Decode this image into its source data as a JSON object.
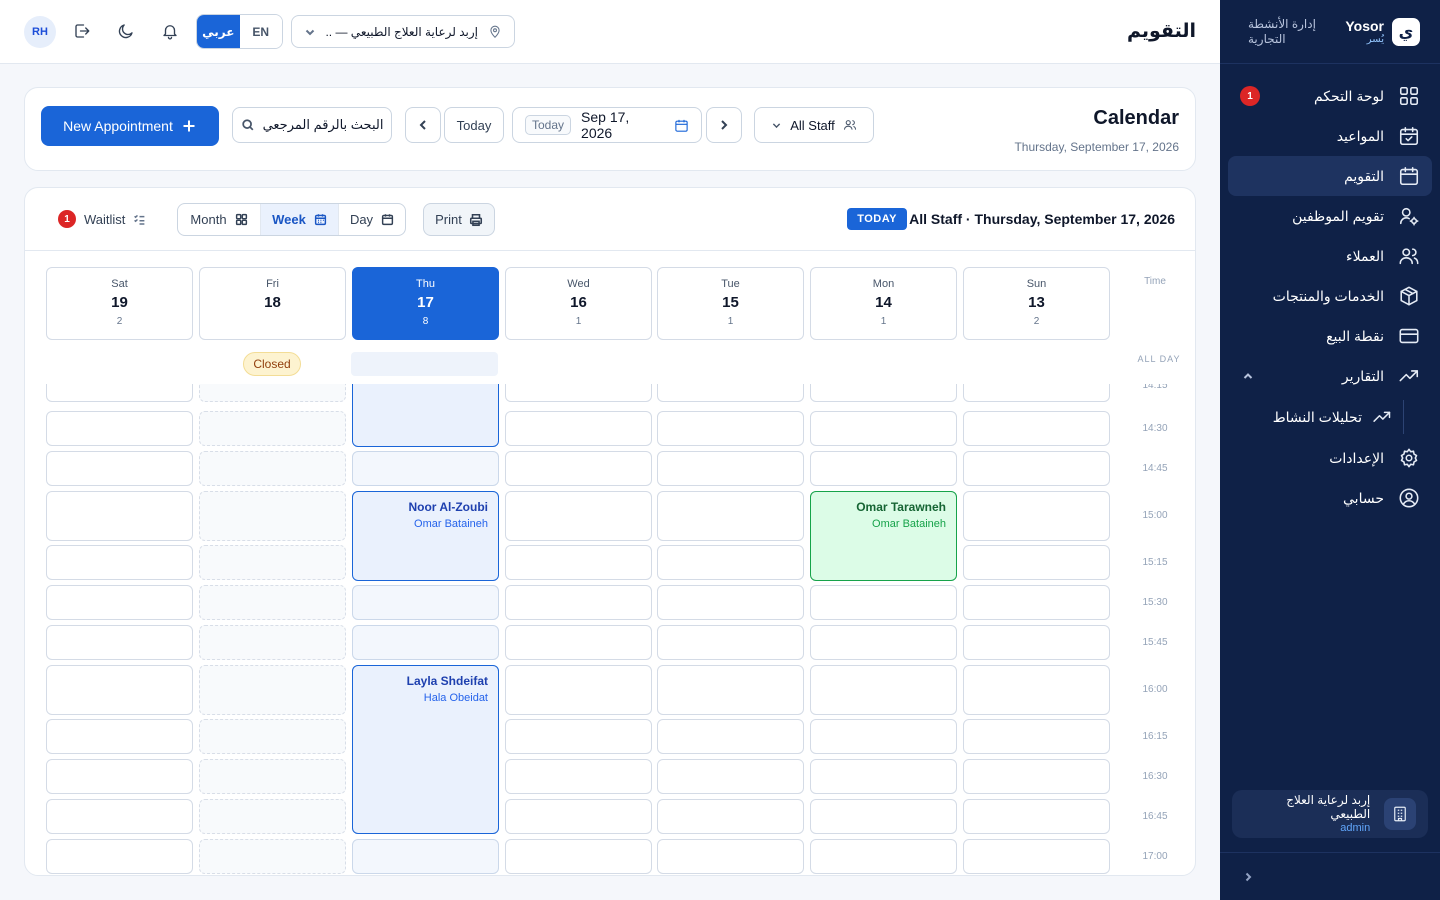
{
  "sidebar": {
    "brand_en": "Yosor",
    "brand_ar": "يُسر",
    "brand_logo": "ي",
    "brand_tagline": "إدارة الأنشطة التجارية",
    "items": [
      {
        "label": "لوحة التحكم",
        "icon": "grid-icon",
        "badge": "1"
      },
      {
        "label": "المواعيد",
        "icon": "calendar-check-icon"
      },
      {
        "label": "التقويم",
        "icon": "calendar-icon",
        "active": true
      },
      {
        "label": "تقويم الموظفين",
        "icon": "user-cog-icon"
      },
      {
        "label": "العملاء",
        "icon": "users-icon"
      },
      {
        "label": "الخدمات والمنتجات",
        "icon": "box-icon"
      },
      {
        "label": "نقطة البيع",
        "icon": "credit-card-icon"
      },
      {
        "label": "التقارير",
        "icon": "trending-up-icon",
        "expanded": true
      },
      {
        "label": "تحليلات النشاط",
        "icon": "trending-up-icon",
        "sub": true
      },
      {
        "label": "الإعدادات",
        "icon": "gear-icon"
      },
      {
        "label": "حسابي",
        "icon": "user-circle-icon"
      }
    ],
    "org_name": "إربد لرعاية العلاج الطبيعي",
    "org_role": "admin"
  },
  "topbar": {
    "title": "التقويم",
    "avatar": "RH",
    "lang_ar": "عربي",
    "lang_en": "EN",
    "branch": "إربد لرعاية العلاج الطبيعي — ..."
  },
  "header": {
    "title": "Calendar",
    "subtitle": "Thursday, September 17, 2026",
    "new_button": "New Appointment",
    "search_placeholder": "البحث بالرقم المرجعي",
    "today_button": "Today",
    "date_chip": "Today",
    "date_value": "Sep 17, 2026",
    "staff_filter": "All Staff"
  },
  "toolbar": {
    "waitlist_label": "Waitlist",
    "waitlist_count": "1",
    "view_month": "Month",
    "view_week": "Week",
    "view_day": "Day",
    "print": "Print",
    "today_tag": "TODAY",
    "range_title": "All Staff · Thursday, September 17, 2026"
  },
  "grid": {
    "time_header": "Time",
    "all_day": "ALL DAY",
    "closed_label": "Closed",
    "days": [
      {
        "name": "Sat",
        "date": "19",
        "count": "2"
      },
      {
        "name": "Fri",
        "date": "18",
        "count": "",
        "closed": true
      },
      {
        "name": "Thu",
        "date": "17",
        "count": "8",
        "today": true
      },
      {
        "name": "Wed",
        "date": "16",
        "count": "1"
      },
      {
        "name": "Tue",
        "date": "15",
        "count": "1"
      },
      {
        "name": "Mon",
        "date": "14",
        "count": "1"
      },
      {
        "name": "Sun",
        "date": "13",
        "count": "2"
      }
    ],
    "slots": [
      "14:15",
      "14:30",
      "14:45",
      "15:00",
      "15:15",
      "15:30",
      "15:45",
      "16:00",
      "16:15",
      "16:30",
      "16:45",
      "17:00"
    ],
    "appointments": [
      {
        "client": "Noor Al-Zoubi",
        "staff": "Omar Bataineh",
        "day": "Thu",
        "color": "blue"
      },
      {
        "client": "Omar Tarawneh",
        "staff": "Omar Bataineh",
        "day": "Mon",
        "color": "green"
      },
      {
        "client": "Layla Shdeifat",
        "staff": "Hala Obeidat",
        "day": "Thu",
        "color": "blue"
      }
    ]
  }
}
